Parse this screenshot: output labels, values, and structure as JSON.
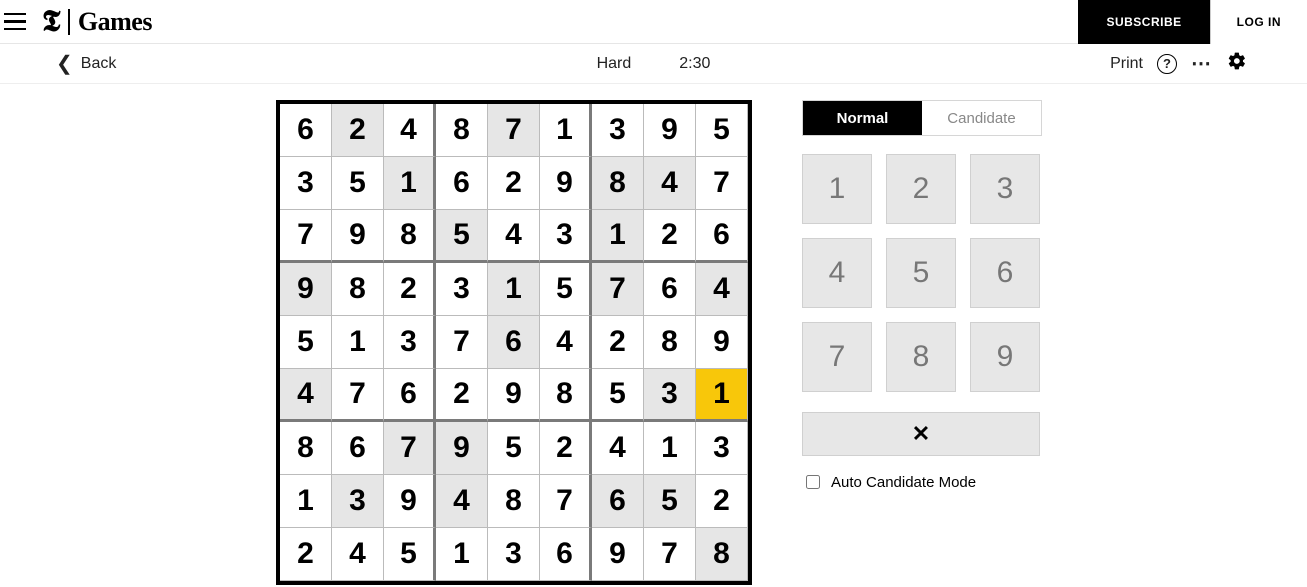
{
  "header": {
    "logo_t": "𝕿",
    "logo_label": "Games",
    "subscribe_label": "SUBSCRIBE",
    "login_label": "LOG IN"
  },
  "subbar": {
    "back_label": "Back",
    "difficulty": "Hard",
    "timer": "2:30",
    "print_label": "Print"
  },
  "controls": {
    "mode_normal": "Normal",
    "mode_candidate": "Candidate",
    "numbers": [
      "1",
      "2",
      "3",
      "4",
      "5",
      "6",
      "7",
      "8",
      "9"
    ],
    "erase_glyph": "✕",
    "auto_candidate_label": "Auto Candidate Mode"
  },
  "sudoku": {
    "selected": [
      5,
      8
    ],
    "grid": [
      [
        {
          "v": "6",
          "g": false
        },
        {
          "v": "2",
          "g": true
        },
        {
          "v": "4",
          "g": false
        },
        {
          "v": "8",
          "g": false
        },
        {
          "v": "7",
          "g": true
        },
        {
          "v": "1",
          "g": false
        },
        {
          "v": "3",
          "g": false
        },
        {
          "v": "9",
          "g": false
        },
        {
          "v": "5",
          "g": false
        }
      ],
      [
        {
          "v": "3",
          "g": false
        },
        {
          "v": "5",
          "g": false
        },
        {
          "v": "1",
          "g": true
        },
        {
          "v": "6",
          "g": false
        },
        {
          "v": "2",
          "g": false
        },
        {
          "v": "9",
          "g": false
        },
        {
          "v": "8",
          "g": true
        },
        {
          "v": "4",
          "g": true
        },
        {
          "v": "7",
          "g": false
        }
      ],
      [
        {
          "v": "7",
          "g": false
        },
        {
          "v": "9",
          "g": false
        },
        {
          "v": "8",
          "g": false
        },
        {
          "v": "5",
          "g": true
        },
        {
          "v": "4",
          "g": false
        },
        {
          "v": "3",
          "g": false
        },
        {
          "v": "1",
          "g": true
        },
        {
          "v": "2",
          "g": false
        },
        {
          "v": "6",
          "g": false
        }
      ],
      [
        {
          "v": "9",
          "g": true
        },
        {
          "v": "8",
          "g": false
        },
        {
          "v": "2",
          "g": false
        },
        {
          "v": "3",
          "g": false
        },
        {
          "v": "1",
          "g": true
        },
        {
          "v": "5",
          "g": false
        },
        {
          "v": "7",
          "g": true
        },
        {
          "v": "6",
          "g": false
        },
        {
          "v": "4",
          "g": true
        }
      ],
      [
        {
          "v": "5",
          "g": false
        },
        {
          "v": "1",
          "g": false
        },
        {
          "v": "3",
          "g": false
        },
        {
          "v": "7",
          "g": false
        },
        {
          "v": "6",
          "g": true
        },
        {
          "v": "4",
          "g": false
        },
        {
          "v": "2",
          "g": false
        },
        {
          "v": "8",
          "g": false
        },
        {
          "v": "9",
          "g": false
        }
      ],
      [
        {
          "v": "4",
          "g": true
        },
        {
          "v": "7",
          "g": false
        },
        {
          "v": "6",
          "g": false
        },
        {
          "v": "2",
          "g": false
        },
        {
          "v": "9",
          "g": false
        },
        {
          "v": "8",
          "g": false
        },
        {
          "v": "5",
          "g": false
        },
        {
          "v": "3",
          "g": true
        },
        {
          "v": "1",
          "g": false
        }
      ],
      [
        {
          "v": "8",
          "g": false
        },
        {
          "v": "6",
          "g": false
        },
        {
          "v": "7",
          "g": true
        },
        {
          "v": "9",
          "g": true
        },
        {
          "v": "5",
          "g": false
        },
        {
          "v": "2",
          "g": false
        },
        {
          "v": "4",
          "g": false
        },
        {
          "v": "1",
          "g": false
        },
        {
          "v": "3",
          "g": false
        }
      ],
      [
        {
          "v": "1",
          "g": false
        },
        {
          "v": "3",
          "g": true
        },
        {
          "v": "9",
          "g": false
        },
        {
          "v": "4",
          "g": true
        },
        {
          "v": "8",
          "g": false
        },
        {
          "v": "7",
          "g": false
        },
        {
          "v": "6",
          "g": true
        },
        {
          "v": "5",
          "g": true
        },
        {
          "v": "2",
          "g": false
        }
      ],
      [
        {
          "v": "2",
          "g": false
        },
        {
          "v": "4",
          "g": false
        },
        {
          "v": "5",
          "g": false
        },
        {
          "v": "1",
          "g": false
        },
        {
          "v": "3",
          "g": false
        },
        {
          "v": "6",
          "g": false
        },
        {
          "v": "9",
          "g": false
        },
        {
          "v": "7",
          "g": false
        },
        {
          "v": "8",
          "g": true
        }
      ]
    ]
  }
}
